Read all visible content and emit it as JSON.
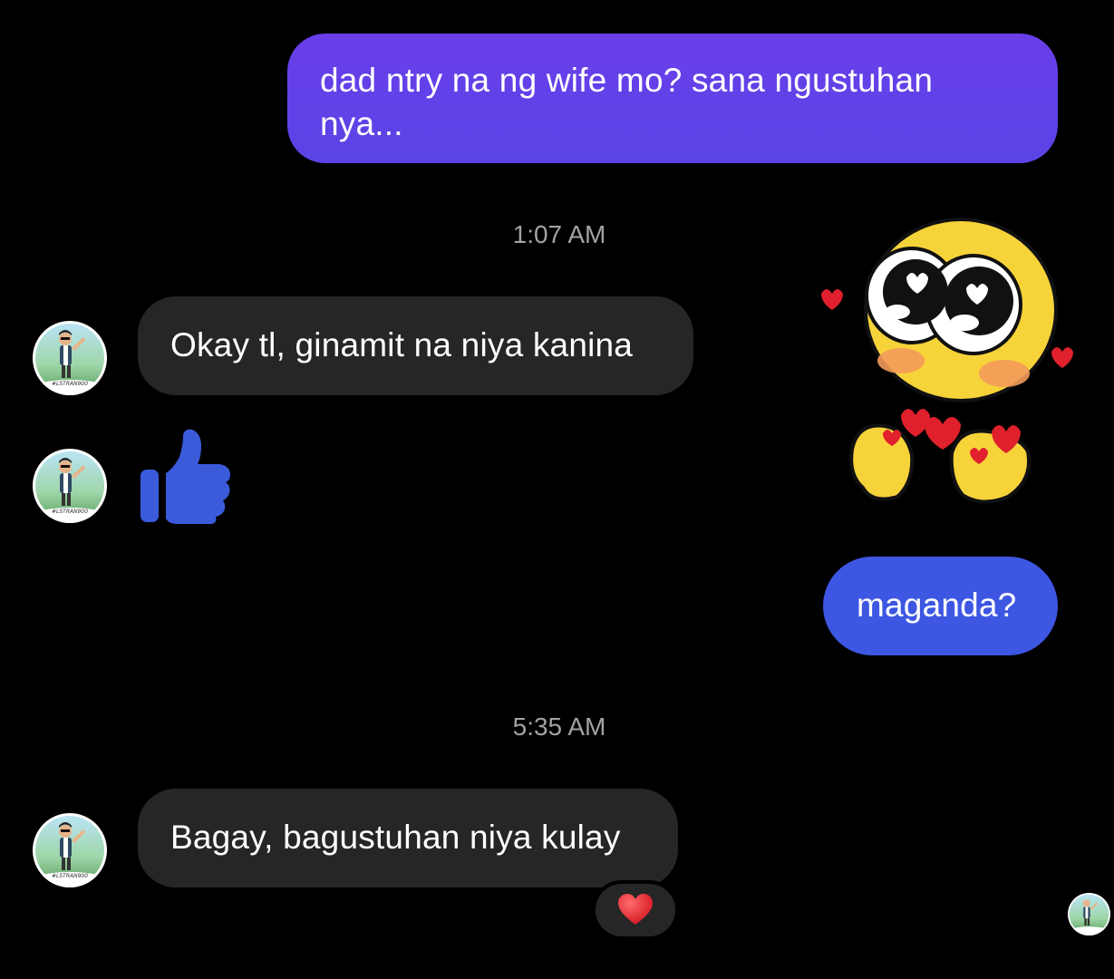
{
  "colors": {
    "background": "#000000",
    "incoming_bubble": "#262626",
    "outgoing_gradient_top": "#6b3ee6",
    "outgoing_gradient_bottom": "#3d57e3",
    "like_blue": "#3b5bdb",
    "timestamp_text": "#a2a2a2",
    "reaction_heart": "#e0202c"
  },
  "messages": {
    "outgoing_1": "dad ntry na ng wife mo? sana ngustuhan nya...",
    "incoming_1": "Okay tl, ginamit na niya kanina",
    "incoming_like_icon": "thumbs-up-icon",
    "outgoing_sticker": "blushing-cursed-emoji-sticker",
    "outgoing_2": "maganda?",
    "incoming_3": "Bagay, bagustuhan niya kulay",
    "reaction_icon": "heart-reaction-icon"
  },
  "timestamps": {
    "first": "1:07 AM",
    "second": "5:35 AM"
  },
  "avatar": {
    "caption": "#LSTRAN900",
    "icon": "avatar-bitmoji-man"
  }
}
